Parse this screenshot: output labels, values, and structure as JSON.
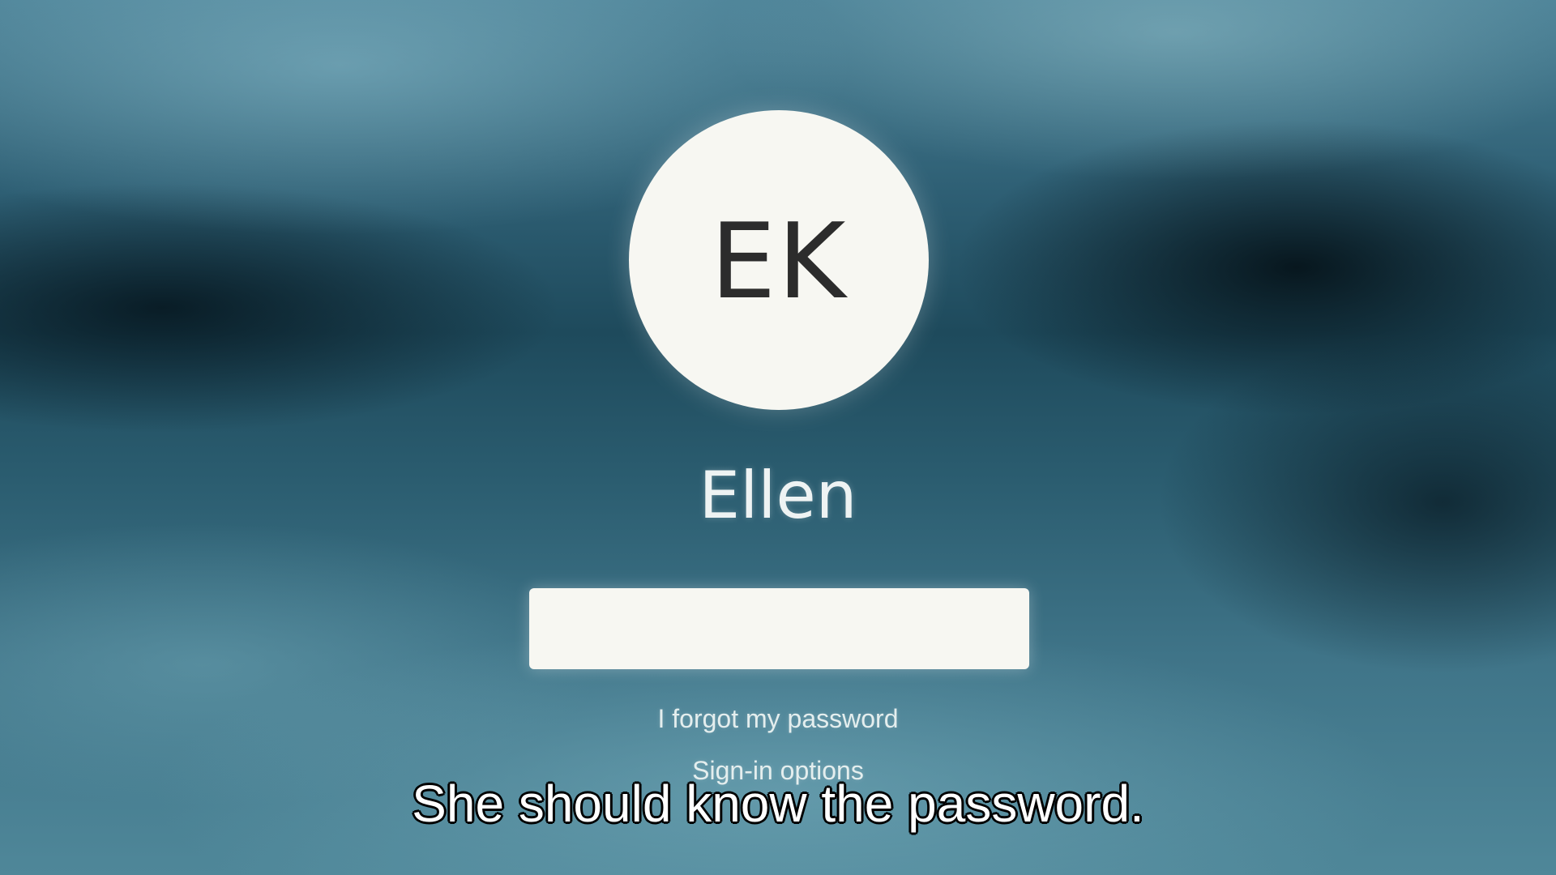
{
  "login": {
    "avatar_initials": "EK",
    "user_name": "Ellen",
    "password": {
      "value": "",
      "placeholder": ""
    },
    "forgot_password_label": "I forgot my password",
    "signin_options_label": "Sign-in options"
  },
  "subtitle": {
    "text": "She should know the password."
  },
  "colors": {
    "avatar_background": "#f7f7f2",
    "initials": "#2c2c2c",
    "foreground_text": "#eef3f3",
    "backdrop_teal": "#2e5f74"
  }
}
